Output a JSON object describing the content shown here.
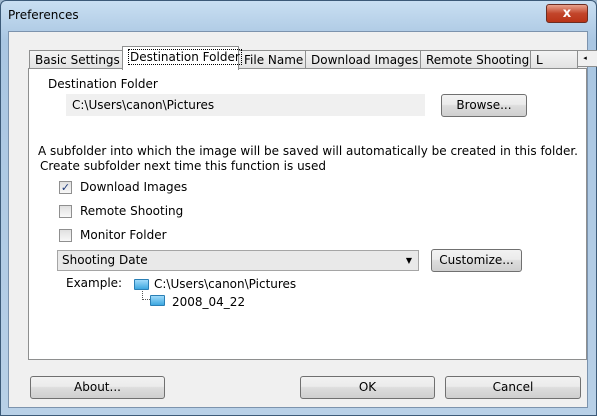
{
  "window": {
    "title": "Preferences",
    "close_glyph": "x"
  },
  "tabs": [
    {
      "label": "Basic Settings",
      "active": false
    },
    {
      "label": "Destination Folder",
      "active": true
    },
    {
      "label": "File Name",
      "active": false
    },
    {
      "label": "Download Images",
      "active": false
    },
    {
      "label": "Remote Shooting",
      "active": false
    },
    {
      "label": "L",
      "active": false
    }
  ],
  "tab_scroll": {
    "left": "◂",
    "right": "▸"
  },
  "destination": {
    "label": "Destination Folder",
    "path": "C:\\Users\\canon\\Pictures",
    "browse_label": "Browse..."
  },
  "subfolder": {
    "description": "A subfolder into which the image will be saved will automatically be created in this folder.",
    "create_label": "Create subfolder next time this function is used",
    "options": [
      {
        "label": "Download Images",
        "checked": true
      },
      {
        "label": "Remote Shooting",
        "checked": false
      },
      {
        "label": "Monitor Folder",
        "checked": false
      }
    ],
    "naming_selected": "Shooting Date",
    "customize_label": "Customize...",
    "example_label": "Example:",
    "example_parent": "C:\\Users\\canon\\Pictures",
    "example_child": "2008_04_22"
  },
  "footer": {
    "about_label": "About...",
    "ok_label": "OK",
    "cancel_label": "Cancel"
  },
  "colors": {
    "folder_icon": "#3ca7e0",
    "close_button": "#c2452a"
  }
}
